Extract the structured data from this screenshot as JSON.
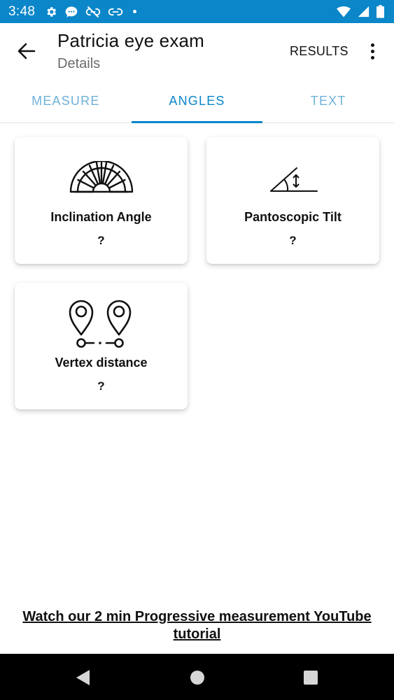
{
  "status_bar": {
    "time": "3:48",
    "left_icons": [
      "gear-icon",
      "chat-icon",
      "link-off-icon",
      "link-icon",
      "dot-icon"
    ],
    "right_icons": [
      "wifi-icon",
      "signal-icon",
      "battery-icon"
    ],
    "background": "#0a86c9"
  },
  "app_bar": {
    "title": "Patricia eye exam",
    "subtitle": "Details",
    "results_label": "RESULTS"
  },
  "tabs": [
    {
      "label": "MEASURE",
      "active": false
    },
    {
      "label": "ANGLES",
      "active": true
    },
    {
      "label": "TEXT",
      "active": false
    }
  ],
  "cards": [
    {
      "label": "Inclination Angle",
      "value": "?",
      "icon": "protractor-icon"
    },
    {
      "label": "Pantoscopic Tilt",
      "value": "?",
      "icon": "tilt-angle-icon"
    },
    {
      "label": "Vertex distance",
      "value": "?",
      "icon": "map-pins-distance-icon"
    }
  ],
  "tutorial_link": "Watch our 2 min Progressive measurement YouTube tutorial",
  "colors": {
    "accent": "#0a86c9",
    "tab_inactive": "#6fb2d8"
  }
}
